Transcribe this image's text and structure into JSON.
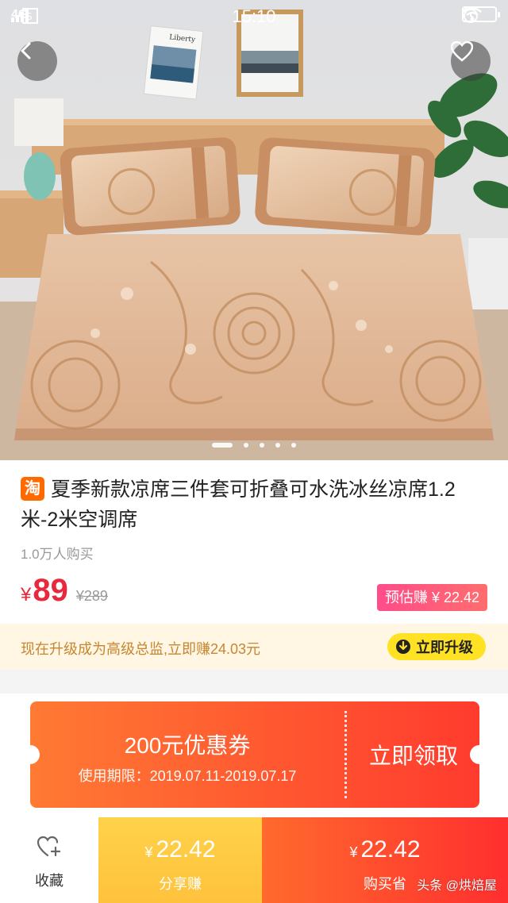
{
  "status_bar": {
    "network": "4G",
    "time": "15:10"
  },
  "hero": {
    "poster_text": "Liberty",
    "carousel_pages": 5,
    "carousel_active": 1
  },
  "product": {
    "platform_badge": "淘",
    "title": "夏季新款凉席三件套可折叠可水洗冰丝凉席1.2米-2米空调席",
    "sold": "1.0万人购买",
    "currency": "¥",
    "price": "89",
    "original_price": "¥289",
    "estimated_earn": "预估赚 ¥ 22.42"
  },
  "upgrade": {
    "text": "现在升级成为高级总监,立即赚24.03元",
    "button": "立即升级"
  },
  "coupon": {
    "amount": "200元优惠券",
    "period": "使用期限：2019.07.11-2019.07.17",
    "claim": "立即领取"
  },
  "bottom_bar": {
    "favorite_label": "收藏",
    "share_currency": "¥",
    "share_amount": "22.42",
    "share_label": "分享赚",
    "buy_currency": "¥",
    "buy_amount": "22.42",
    "buy_label": "购买省",
    "watermark": "头条 @烘焙屋"
  },
  "colors": {
    "price_red": "#e8283c",
    "upgrade_yellow": "#ffe224",
    "coupon_orange": "#ff5a2e",
    "share_yellow": "#ffc83f",
    "buy_red": "#ff3c2e"
  },
  "icons": [
    "back-arrow-icon",
    "heart-icon",
    "sim-icon",
    "alarm-icon",
    "wifi-icon",
    "battery-icon",
    "download-circle-icon",
    "heart-plus-icon"
  ]
}
